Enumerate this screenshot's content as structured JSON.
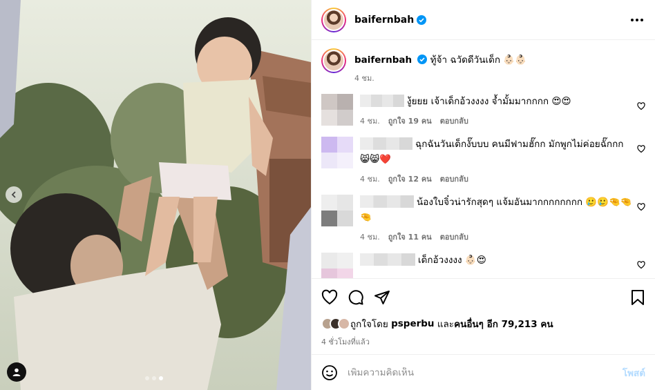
{
  "post": {
    "username": "baifernbah",
    "caption": "ทู้จ้า ฉวัดดีวันเด็ก 👶🏻👶🏻",
    "caption_time": "4 ชม.",
    "likes_prefix": "ถูกใจโดย",
    "likes_user": "psperbu",
    "likes_and": "และ",
    "likes_others": "คนอื่นๆ อีก 79,213 คน",
    "time_ago": "4 ชั่วโมงที่แล้ว"
  },
  "comments": [
    {
      "text": "งู้ยยย เจ้าเด็กอ้วงงงง จ้ำมั้มมากกกก 😍😍",
      "time": "4 ชม.",
      "likes": "ถูกใจ 19 คน",
      "reply": "ตอบกลับ",
      "blur_w": 64
    },
    {
      "text": "ฉุกฉันวันเด็กงั๊บบบ คนมีฟามฮั๊กก มักพูกไม่ค่อยฉั๊กกก 😸😸❤️",
      "time": "4 ชม.",
      "likes": "ถูกใจ 12 คน",
      "reply": "ตอบกลับ",
      "blur_w": 76
    },
    {
      "text": "น้องใบจิ๋วน่ารักสุดๆ แจ้มอันมากกกกกกกก 🥲🥲🤏🤏🤏",
      "time": "4 ชม.",
      "likes": "ถูกใจ 11 คน",
      "reply": "ตอบกลับ",
      "blur_w": 78
    },
    {
      "text": "เด็กอ้วงงงง 👶🏻😍",
      "time": "",
      "likes": "",
      "reply": "",
      "blur_w": 80
    }
  ],
  "add_comment": {
    "placeholder": "เพิ่มความคิดเห็น",
    "post_label": "โพสต์"
  },
  "icons": {
    "verified": "verified-badge-icon",
    "more": "more-horizontal-icon",
    "heart": "heart-icon",
    "comment": "comment-icon",
    "share": "share-icon",
    "save": "bookmark-icon",
    "emoji": "emoji-icon",
    "prev": "chevron-left-icon",
    "tag": "person-tag-icon"
  },
  "colors": {
    "accent": "#0095f6",
    "muted": "#737373",
    "post_disabled": "#b3dbff"
  }
}
